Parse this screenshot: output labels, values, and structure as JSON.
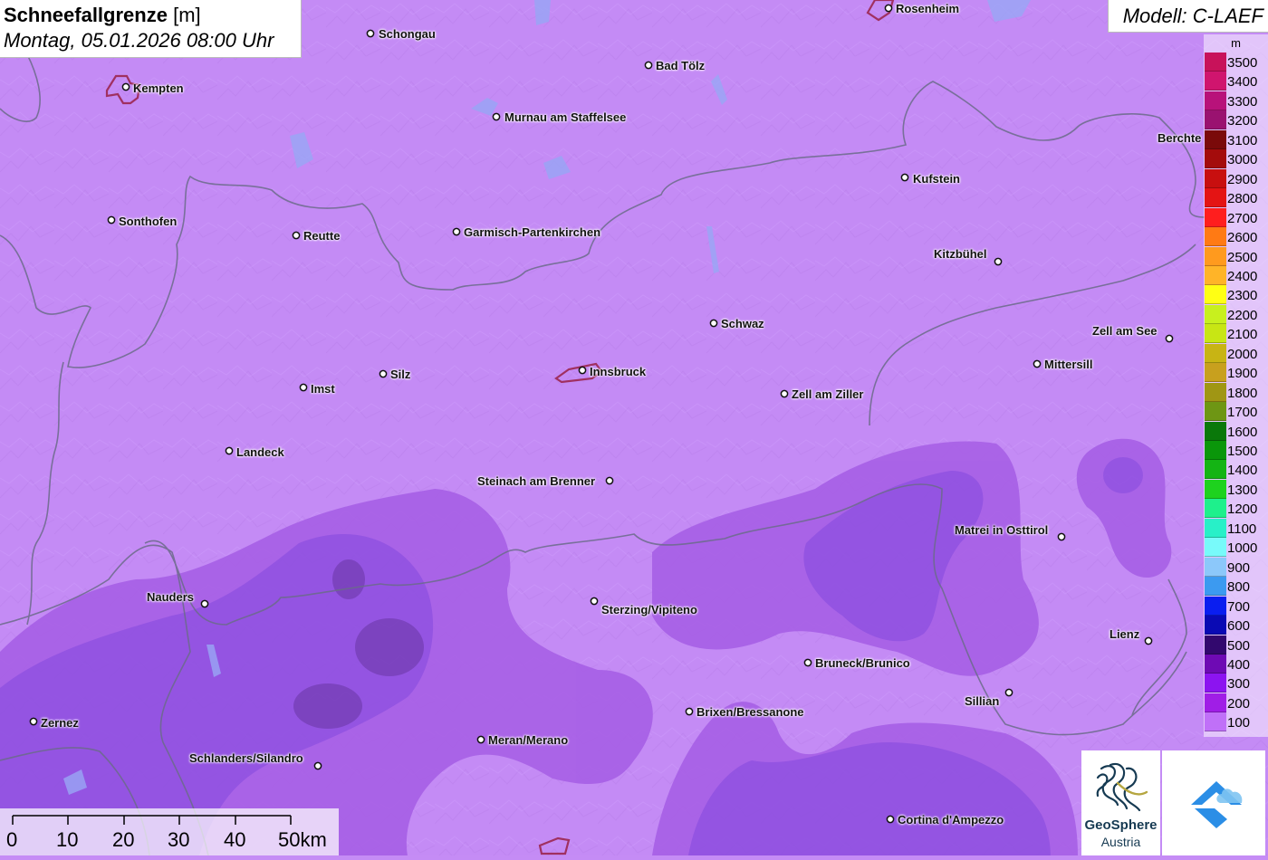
{
  "title": {
    "main": "Schneefallgrenze",
    "unit": "[m]",
    "datetime": "Montag, 05.01.2026 08:00 Uhr"
  },
  "model": "Modell: C-LAEF",
  "legend": {
    "unit": "m",
    "items": [
      {
        "label": "3500",
        "color": "#c8125a"
      },
      {
        "label": "3400",
        "color": "#d0156e"
      },
      {
        "label": "3300",
        "color": "#b8127a"
      },
      {
        "label": "3200",
        "color": "#9a1270"
      },
      {
        "label": "3100",
        "color": "#7a0a0a"
      },
      {
        "label": "3000",
        "color": "#a40c0c"
      },
      {
        "label": "2900",
        "color": "#c80f0f"
      },
      {
        "label": "2800",
        "color": "#e41414"
      },
      {
        "label": "2700",
        "color": "#ff1e1e"
      },
      {
        "label": "2600",
        "color": "#ff7a14"
      },
      {
        "label": "2500",
        "color": "#ff9a1e"
      },
      {
        "label": "2400",
        "color": "#ffb428"
      },
      {
        "label": "2300",
        "color": "#ffff14"
      },
      {
        "label": "2200",
        "color": "#c8f01e"
      },
      {
        "label": "2100",
        "color": "#c8e614"
      },
      {
        "label": "2000",
        "color": "#c8b414"
      },
      {
        "label": "1900",
        "color": "#c8a01e"
      },
      {
        "label": "1800",
        "color": "#a09614"
      },
      {
        "label": "1700",
        "color": "#6e9614"
      },
      {
        "label": "1600",
        "color": "#0a780a"
      },
      {
        "label": "1500",
        "color": "#0a960a"
      },
      {
        "label": "1400",
        "color": "#14b414"
      },
      {
        "label": "1300",
        "color": "#1ed21e"
      },
      {
        "label": "1200",
        "color": "#1ef08c"
      },
      {
        "label": "1100",
        "color": "#28f0c8"
      },
      {
        "label": "1000",
        "color": "#78fafa"
      },
      {
        "label": "900",
        "color": "#8cc8fa"
      },
      {
        "label": "800",
        "color": "#3c9af0"
      },
      {
        "label": "700",
        "color": "#0a1ef0"
      },
      {
        "label": "600",
        "color": "#0a0ab4"
      },
      {
        "label": "500",
        "color": "#32086e"
      },
      {
        "label": "400",
        "color": "#6e0ab4"
      },
      {
        "label": "300",
        "color": "#8c14f0"
      },
      {
        "label": "200",
        "color": "#a01ee6"
      },
      {
        "label": "100",
        "color": "#c070f8"
      }
    ]
  },
  "cities": [
    {
      "name": "Schongau"
    },
    {
      "name": "Rosenheim"
    },
    {
      "name": "Bad Tölz"
    },
    {
      "name": "Kempten"
    },
    {
      "name": "Murnau am Staffelsee"
    },
    {
      "name": "Berchte"
    },
    {
      "name": "Kufstein"
    },
    {
      "name": "Sonthofen"
    },
    {
      "name": "Reutte"
    },
    {
      "name": "Garmisch-Partenkirchen"
    },
    {
      "name": "Kitzbühel"
    },
    {
      "name": "Schwaz"
    },
    {
      "name": "Zell am See"
    },
    {
      "name": "Mittersill"
    },
    {
      "name": "Silz"
    },
    {
      "name": "Innsbruck"
    },
    {
      "name": "Imst"
    },
    {
      "name": "Zell am Ziller"
    },
    {
      "name": "Landeck"
    },
    {
      "name": "Steinach am Brenner"
    },
    {
      "name": "Matrei in Osttirol"
    },
    {
      "name": "Nauders"
    },
    {
      "name": "Sterzing/Vipiteno"
    },
    {
      "name": "Lienz"
    },
    {
      "name": "Bruneck/Brunico"
    },
    {
      "name": "Sillian"
    },
    {
      "name": "Brixen/Bressanone"
    },
    {
      "name": "Zernez"
    },
    {
      "name": "Meran/Merano"
    },
    {
      "name": "Schlanders/Silandro"
    },
    {
      "name": "Cortina d'Ampezzo"
    }
  ],
  "scale_bar": {
    "ticks": [
      "0",
      "10",
      "20",
      "30",
      "40",
      "50km"
    ]
  },
  "logos": {
    "geosphere_line1": "GeoSphere",
    "geosphere_line2": "Austria"
  }
}
